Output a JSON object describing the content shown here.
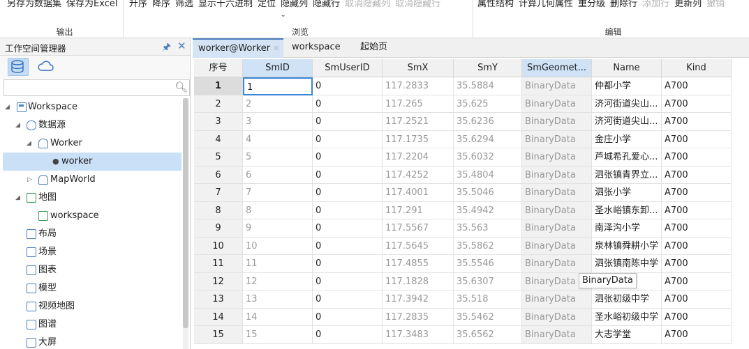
{
  "ribbon": {
    "output": {
      "buttons": [
        "另存为数据集",
        "保存为Excel"
      ],
      "label": "输出"
    },
    "browse": {
      "buttons": [
        "升序",
        "降序",
        "筛选",
        "显示十六进制",
        "定位",
        "隐藏列",
        "隐藏行",
        "取消隐藏列",
        "取消隐藏行"
      ],
      "label": "浏览"
    },
    "edit": {
      "buttons": [
        "属性结构",
        "计算几何属性",
        "重分级",
        "删除行",
        "添加行",
        "更新列",
        "撤销"
      ],
      "label": "编辑"
    }
  },
  "workspace_manager": {
    "title": "工作空间管理器",
    "tree": [
      {
        "label": "Workspace",
        "icon": "workspace-icon"
      },
      {
        "label": "数据源",
        "icon": "datasources-icon"
      },
      {
        "label": "Worker",
        "icon": "datasource-icon"
      },
      {
        "label": "worker",
        "icon": "dataset-point-icon"
      },
      {
        "label": "MapWorld",
        "icon": "datasource-icon"
      },
      {
        "label": "地图",
        "icon": "maps-icon"
      },
      {
        "label": "workspace",
        "icon": "map-icon"
      },
      {
        "label": "布局",
        "icon": "layout-icon"
      },
      {
        "label": "场景",
        "icon": "scene-icon"
      },
      {
        "label": "图表",
        "icon": "chart-icon"
      },
      {
        "label": "模型",
        "icon": "model-icon"
      },
      {
        "label": "视频地图",
        "icon": "video-map-icon"
      },
      {
        "label": "图谱",
        "icon": "graph-icon"
      },
      {
        "label": "大屏",
        "icon": "dashboard-icon"
      }
    ]
  },
  "tabs": [
    {
      "label": "worker@Worker"
    },
    {
      "label": "workspace"
    },
    {
      "label": "起始页"
    }
  ],
  "table": {
    "columns": [
      "序号",
      "SmID",
      "SmUserID",
      "SmX",
      "SmY",
      "SmGeomet...",
      "Name",
      "Kind"
    ],
    "rows": [
      [
        "1",
        "1",
        "0",
        "117.2833",
        "35.5884",
        "BinaryData",
        "仲都小学",
        "A700"
      ],
      [
        "2",
        "2",
        "0",
        "117.265",
        "35.625",
        "BinaryData",
        "济河街道尖山...",
        "A700"
      ],
      [
        "3",
        "3",
        "0",
        "117.2521",
        "35.6236",
        "BinaryData",
        "济河街道尖山...",
        "A700"
      ],
      [
        "4",
        "4",
        "0",
        "117.1735",
        "35.6294",
        "BinaryData",
        "金庄小学",
        "A700"
      ],
      [
        "5",
        "5",
        "0",
        "117.2204",
        "35.6032",
        "BinaryData",
        "芦城希孔爱心...",
        "A700"
      ],
      [
        "6",
        "6",
        "0",
        "117.4252",
        "35.4804",
        "BinaryData",
        "泗张镇青界立...",
        "A700"
      ],
      [
        "7",
        "7",
        "0",
        "117.4001",
        "35.5046",
        "BinaryData",
        "泗张小学",
        "A700"
      ],
      [
        "8",
        "8",
        "0",
        "117.291",
        "35.4942",
        "BinaryData",
        "圣水峪镇东卸...",
        "A700"
      ],
      [
        "9",
        "9",
        "0",
        "117.5567",
        "35.563",
        "BinaryData",
        "南泽沟小学",
        "A700"
      ],
      [
        "10",
        "10",
        "0",
        "117.5645",
        "35.5862",
        "BinaryData",
        "泉林镇舜耕小学",
        "A700"
      ],
      [
        "11",
        "11",
        "0",
        "117.4855",
        "35.5546",
        "BinaryData",
        "泗张镇南陈中学",
        "A700"
      ],
      [
        "12",
        "12",
        "0",
        "117.1828",
        "35.6307",
        "BinaryData",
        "心中学",
        "A700"
      ],
      [
        "13",
        "13",
        "0",
        "117.3942",
        "35.518",
        "BinaryData",
        "泗张初级中学",
        "A700"
      ],
      [
        "14",
        "14",
        "0",
        "117.2835",
        "35.5462",
        "BinaryData",
        "圣水峪初级中学",
        "A700"
      ],
      [
        "15",
        "15",
        "0",
        "117.3483",
        "35.6562",
        "BinaryData",
        "大志学堂",
        "A700"
      ]
    ],
    "tooltip": "BinaryData"
  }
}
